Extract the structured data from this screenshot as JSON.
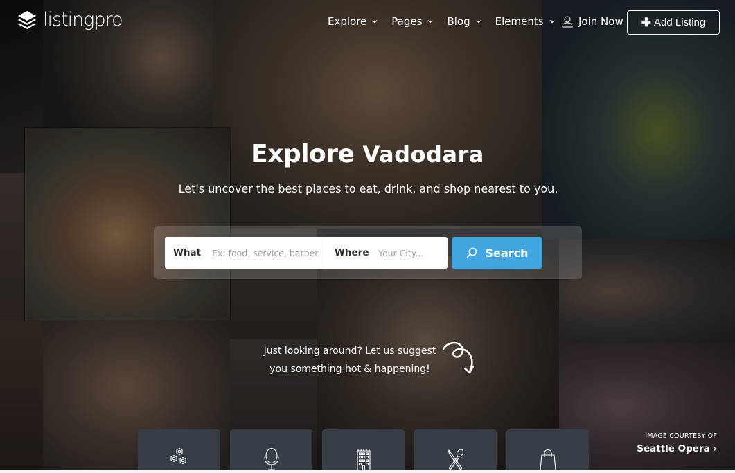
{
  "header": {
    "logo_text": "listingpro",
    "nav": [
      {
        "label": "Explore",
        "has_dropdown": true
      },
      {
        "label": "Pages",
        "has_dropdown": true
      },
      {
        "label": "Blog",
        "has_dropdown": true
      },
      {
        "label": "Elements",
        "has_dropdown": true
      }
    ],
    "join_label": "Join Now",
    "add_listing_label": "Add Listing"
  },
  "hero": {
    "title_prefix": "Explore",
    "title_city": "Vadodara",
    "subtitle": "Let's uncover the best places to eat, drink, and shop nearest to you."
  },
  "search": {
    "what_label": "What",
    "what_placeholder": "Ex: food, service, barber, hotel",
    "what_value": "",
    "where_label": "Where",
    "where_placeholder": "Your City...",
    "where_value": "",
    "button_label": "Search",
    "button_color": "#41a6e0"
  },
  "suggest": {
    "line1": "Just looking around? Let us suggest",
    "line2": "you something hot & happening!"
  },
  "categories": [
    {
      "icon": "gears-icon"
    },
    {
      "icon": "mirror-icon"
    },
    {
      "icon": "hotel-building-icon"
    },
    {
      "icon": "knife-spoon-icon"
    },
    {
      "icon": "shopping-bag-icon"
    }
  ],
  "courtesy": {
    "label": "IMAGE COURTESY OF",
    "link": "Seattle Opera"
  }
}
